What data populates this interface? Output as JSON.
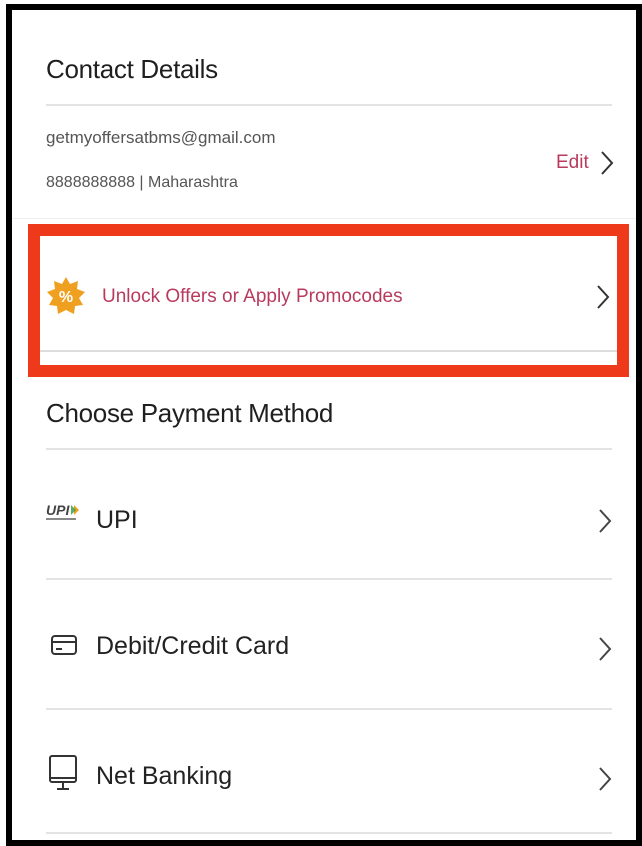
{
  "contact": {
    "title": "Contact Details",
    "email": "getmyoffersatbms@gmail.com",
    "phone_region": "8888888888 | Maharashtra",
    "edit_label": "Edit"
  },
  "promo": {
    "label": "Unlock Offers or Apply Promocodes",
    "icon": "discount-badge-icon",
    "icon_symbol": "%",
    "highlight_color": "#ee3a1a"
  },
  "payment": {
    "title": "Choose Payment Method",
    "methods": [
      {
        "label": "UPI",
        "icon": "upi-logo-icon"
      },
      {
        "label": "Debit/Credit Card",
        "icon": "card-icon"
      },
      {
        "label": "Net Banking",
        "icon": "monitor-icon"
      }
    ]
  },
  "colors": {
    "accent": "#b83b5e",
    "badge": "#f0a021",
    "divider": "#e3e3e3"
  }
}
